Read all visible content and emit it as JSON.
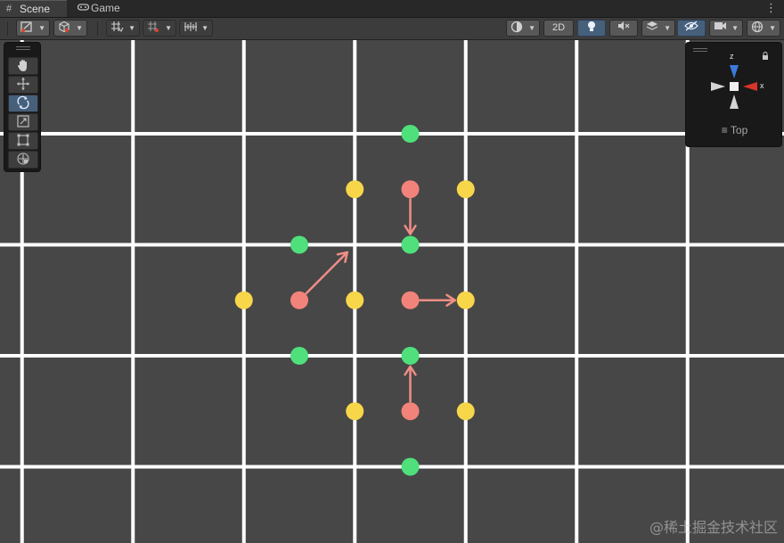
{
  "tabs": [
    {
      "label": "Scene",
      "icon": "grid-icon",
      "active": true
    },
    {
      "label": "Game",
      "icon": "gamepad-icon",
      "active": false
    }
  ],
  "tab_menu_icon": "kebab-menu-icon",
  "toolbar": {
    "left_groups": [
      "draw-mode-dropdown",
      "render-mode-dropdown",
      "grid-snapping-dropdown",
      "increment-snapping-dropdown",
      "grid-ruler-dropdown"
    ],
    "right_2d_label": "2D",
    "accent": "#46607c"
  },
  "tools": [
    "hand-tool",
    "move-tool",
    "rotate-tool",
    "scale-tool",
    "rect-tool",
    "transform-tool"
  ],
  "active_tool": "rotate-tool",
  "gizmo": {
    "axis_z": "z",
    "axis_x": "x",
    "view_label": "Top",
    "colors": {
      "z": "#3a7bdc",
      "x": "#d8352b",
      "neutral": "#d4d4d4"
    }
  },
  "scene": {
    "background": "#474747",
    "grid_color": "#ffffff",
    "colors": {
      "red": "#f2837a",
      "green": "#4fe07c",
      "yellow": "#f8d64a",
      "arrow": "#f08d85"
    },
    "points": [
      {
        "color": "green",
        "gx": 3,
        "gy": 0
      },
      {
        "color": "green",
        "gx": 2,
        "gy": 1
      },
      {
        "color": "green",
        "gx": 3,
        "gy": 1
      },
      {
        "color": "green",
        "gx": 2,
        "gy": 2
      },
      {
        "color": "green",
        "gx": 3,
        "gy": 2
      },
      {
        "color": "green",
        "gx": 3,
        "gy": 3
      },
      {
        "color": "yellow",
        "gx": 2.5,
        "gy": 0.5
      },
      {
        "color": "yellow",
        "gx": 3.5,
        "gy": 0.5
      },
      {
        "color": "yellow",
        "gx": 1.5,
        "gy": 1.5
      },
      {
        "color": "yellow",
        "gx": 2.5,
        "gy": 1.5
      },
      {
        "color": "yellow",
        "gx": 3.5,
        "gy": 1.5
      },
      {
        "color": "yellow",
        "gx": 2.5,
        "gy": 2.5
      },
      {
        "color": "yellow",
        "gx": 3.5,
        "gy": 2.5
      },
      {
        "color": "red",
        "gx": 3,
        "gy": 0.5
      },
      {
        "color": "red",
        "gx": 2,
        "gy": 1.5
      },
      {
        "color": "red",
        "gx": 3,
        "gy": 1.5
      },
      {
        "color": "red",
        "gx": 3,
        "gy": 2.5
      }
    ],
    "arrows": [
      {
        "from": [
          3,
          0.5
        ],
        "to": [
          3,
          1
        ]
      },
      {
        "from": [
          2,
          1.5
        ],
        "to": [
          2.5,
          1
        ]
      },
      {
        "from": [
          3,
          1.5
        ],
        "to": [
          3.5,
          1.5
        ]
      },
      {
        "from": [
          3,
          2.5
        ],
        "to": [
          3,
          2
        ]
      }
    ]
  },
  "watermark": "@稀土掘金技术社区"
}
